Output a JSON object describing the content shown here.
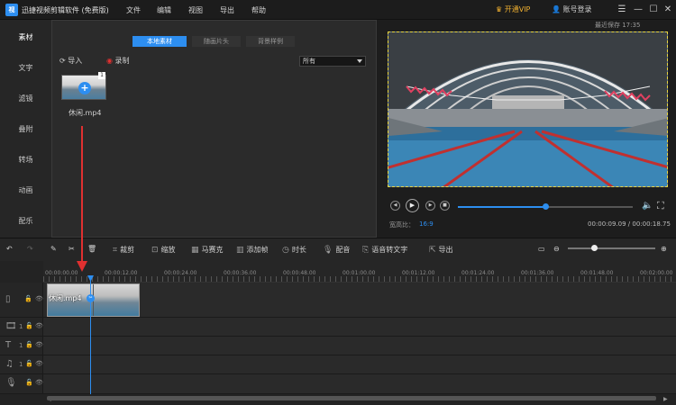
{
  "app": {
    "title": "迅捷视频剪辑软件 (免费版)",
    "logo": "视"
  },
  "menu": [
    "文件",
    "编辑",
    "视图",
    "导出",
    "帮助"
  ],
  "header": {
    "vip_label": "开通VIP",
    "login_label": "账号登录",
    "autosave": "最近保存 17:35"
  },
  "sidebar": {
    "items": [
      "素材",
      "文字",
      "滤镜",
      "叠附",
      "转场",
      "动画",
      "配乐"
    ]
  },
  "library": {
    "tabs": [
      "本地素材",
      "随画片头",
      "背景样例"
    ],
    "import_label": "导入",
    "record_label": "录制",
    "filter_value": "所有",
    "media": {
      "name": "休闲.mp4",
      "badge": "1"
    }
  },
  "player": {
    "aspect_label": "宽高比：",
    "aspect_value": "16:9",
    "current_time": "00:00:09.09",
    "total_time": "00:00:18.75",
    "progress": 0.5
  },
  "toolbar": {
    "tools": [
      "裁剪",
      "缩放",
      "马赛克",
      "添加帧",
      "时长",
      "配音",
      "语音转文字",
      "导出"
    ]
  },
  "timeline": {
    "ticks": [
      "00:00:00.00",
      "00:00:12.00",
      "00:00:24.00",
      "00:00:36.00",
      "00:00:48.00",
      "00:01:00.00",
      "00:01:12.00",
      "00:01:24.00",
      "00:01:36.00",
      "00:01:48.00",
      "00:02:00.00"
    ],
    "clip_label": "休闲.mp4",
    "track_counts": [
      "1",
      "1",
      "1"
    ]
  },
  "colors": {
    "accent": "#2d8ef0",
    "vip": "#f0b030",
    "arrow": "#e03030",
    "selection": "#e8d640"
  }
}
